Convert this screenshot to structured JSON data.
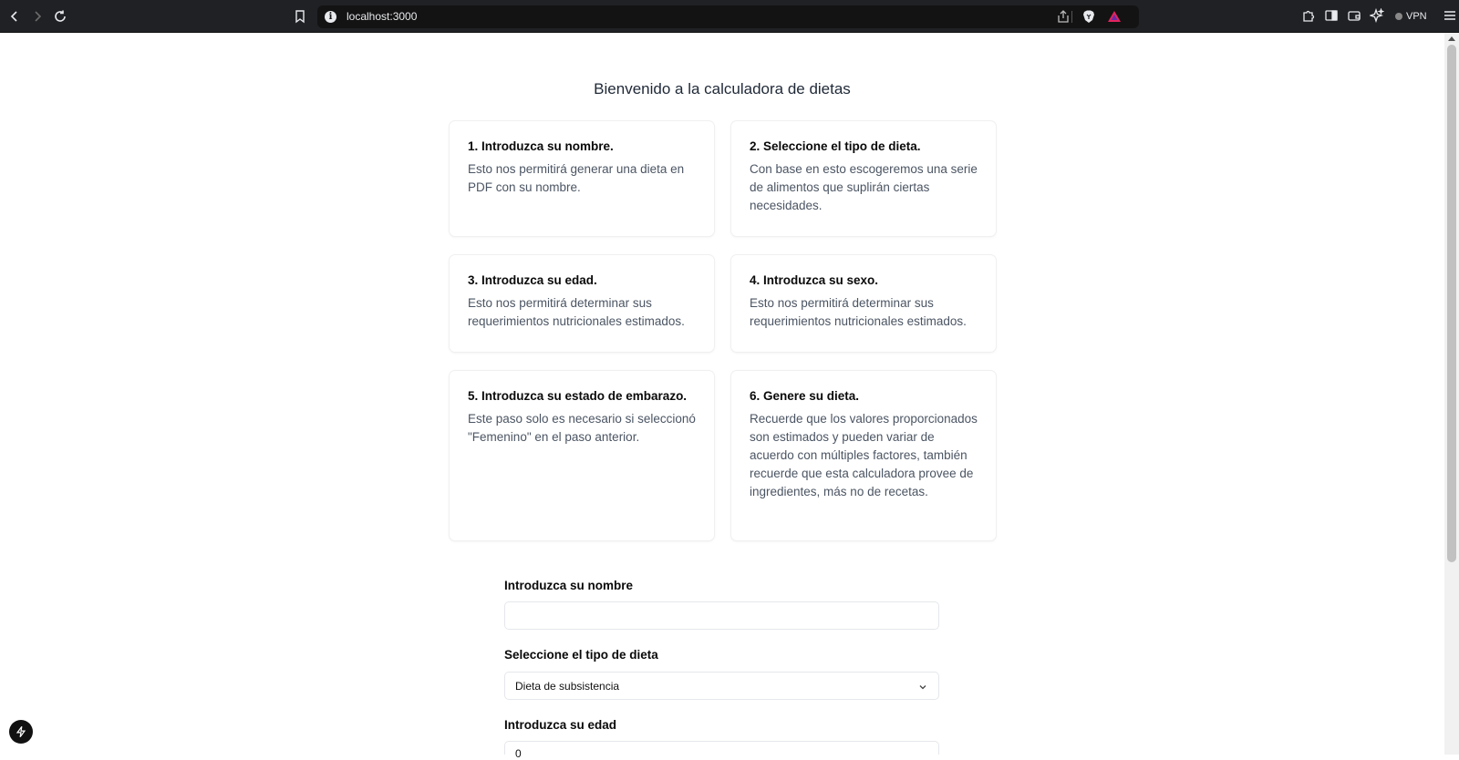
{
  "browser": {
    "url": "localhost:3000",
    "vpn_label": "VPN"
  },
  "page": {
    "title": "Bienvenido a la calculadora de dietas"
  },
  "steps": [
    {
      "title": "1. Introduzca su nombre.",
      "text": "Esto nos permitirá generar una dieta en PDF con su nombre."
    },
    {
      "title": "2. Seleccione el tipo de dieta.",
      "text": "Con base en esto escogeremos una serie de alimentos que suplirán ciertas necesidades."
    },
    {
      "title": "3. Introduzca su edad.",
      "text": "Esto nos permitirá determinar sus requerimientos nutricionales estimados."
    },
    {
      "title": "4. Introduzca su sexo.",
      "text": "Esto nos permitirá determinar sus requerimientos nutricionales estimados."
    },
    {
      "title": "5. Introduzca su estado de embarazo.",
      "text": "Este paso solo es necesario si seleccionó \"Femenino\" en el paso anterior."
    },
    {
      "title": "6. Genere su dieta.",
      "text": "Recuerde que los valores proporcionados son estimados y pueden variar de acuerdo con múltiples factores, también recuerde que esta calculadora provee de ingredientes, más no de recetas."
    }
  ],
  "form": {
    "name_label": "Introduzca su nombre",
    "name_value": "",
    "diet_label": "Seleccione el tipo de dieta",
    "diet_value": "Dieta de subsistencia",
    "age_label": "Introduzca su edad",
    "age_value": "0"
  },
  "icons": {
    "back": "arrow-left-icon",
    "forward": "arrow-right-icon",
    "reload": "reload-icon",
    "bookmark": "bookmark-icon",
    "site_info": "info-icon",
    "share": "share-icon",
    "brave_shields": "brave-lion-icon",
    "brave_rewards": "rewards-triangle-icon",
    "extensions": "puzzle-icon",
    "sidebar": "sidebar-icon",
    "wallet": "wallet-icon",
    "leo": "sparkle-icon",
    "menu": "hamburger-icon",
    "dev_badge": "lightning-icon"
  }
}
